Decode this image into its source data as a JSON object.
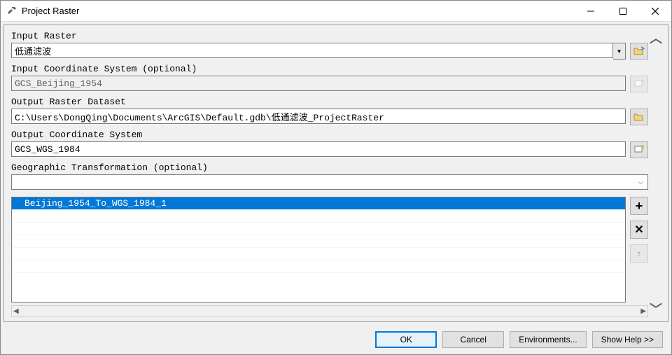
{
  "window": {
    "title": "Project Raster"
  },
  "fields": {
    "input_raster": {
      "label": "Input Raster",
      "value": "低通滤波"
    },
    "input_cs": {
      "label": "Input Coordinate System (optional)",
      "value": "GCS_Beijing_1954"
    },
    "output_raster": {
      "label": "Output Raster Dataset",
      "value": "C:\\Users\\DongQing\\Documents\\ArcGIS\\Default.gdb\\低通滤波_ProjectRaster"
    },
    "output_cs": {
      "label": "Output Coordinate System",
      "value": "GCS_WGS_1984"
    },
    "geo_transform": {
      "label": "Geographic Transformation (optional)",
      "value": ""
    }
  },
  "transform_list": {
    "items": [
      "Beijing_1954_To_WGS_1984_1"
    ],
    "selected_index": 0
  },
  "buttons": {
    "ok": "OK",
    "cancel": "Cancel",
    "environments": "Environments...",
    "show_help": "Show Help >>",
    "add": "+",
    "remove": "✕",
    "up": "↑"
  }
}
